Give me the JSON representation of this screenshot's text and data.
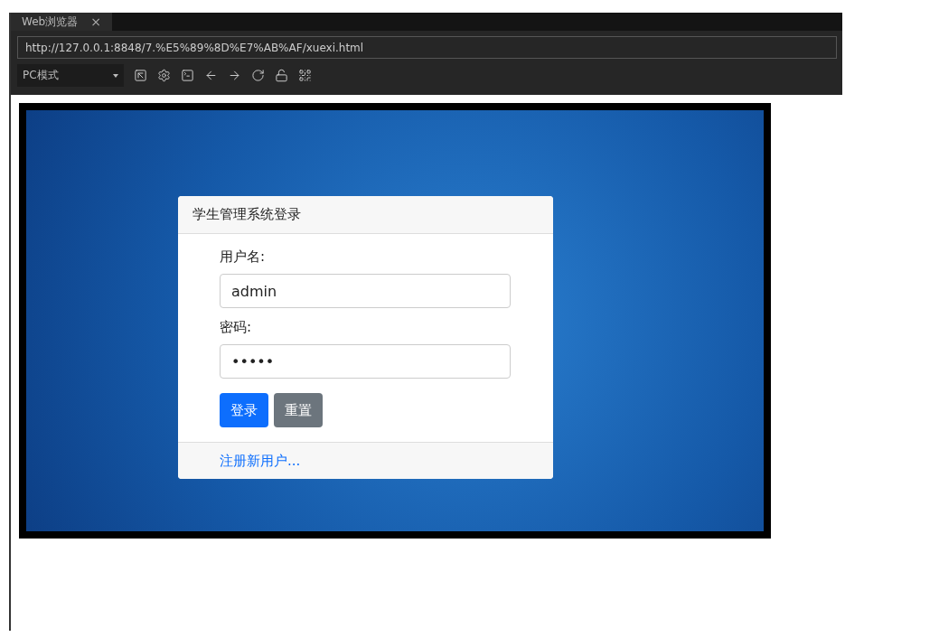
{
  "browser": {
    "tab": {
      "label": "Web浏览器",
      "close": "×",
      "selected": true
    },
    "url": "http://127.0.0.1:8848/7.%E5%89%8D%E7%AB%AF/xuexi.html",
    "mode": "PC模式"
  },
  "login_card": {
    "title": "学生管理系统登录",
    "fields": [
      {
        "label": "用户名:",
        "value": "admin"
      },
      {
        "label": "密码:",
        "value": "•••••"
      }
    ],
    "buttons": [
      {
        "label": "登录",
        "kind": "primary"
      },
      {
        "label": "重置",
        "kind": "secondary"
      }
    ],
    "footer_link": "注册新用户..."
  }
}
